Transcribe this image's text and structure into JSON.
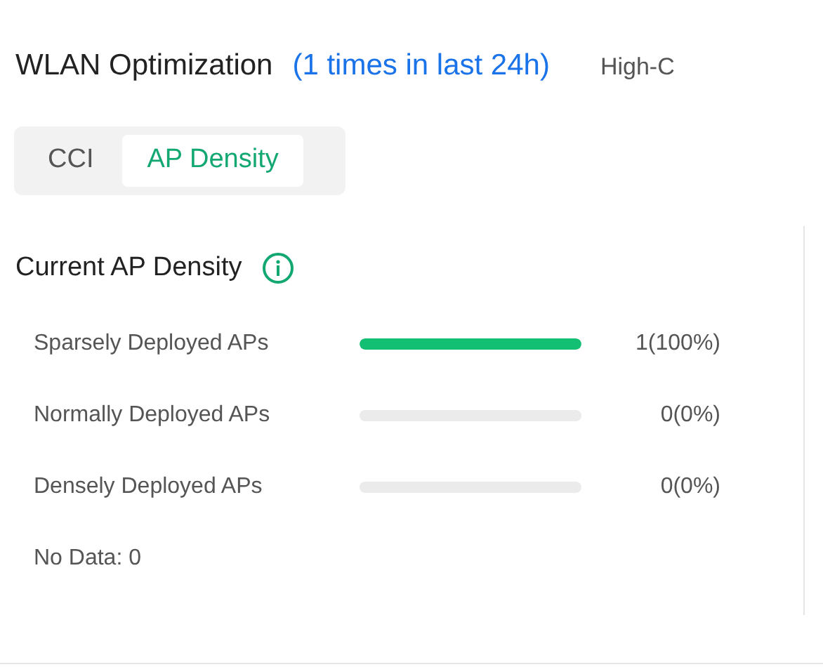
{
  "header": {
    "title": "WLAN Optimization",
    "count": "(1 times in last 24h)",
    "next_section": "High-C"
  },
  "tabs": [
    {
      "label": "CCI",
      "selected": false
    },
    {
      "label": "AP Density",
      "selected": true
    }
  ],
  "density": {
    "title": "Current AP Density",
    "rows": [
      {
        "label": "Sparsely Deployed APs",
        "level": 1,
        "reading": "1(100%)"
      },
      {
        "label": "Normally Deployed APs",
        "level": 0,
        "reading": "0(0%)"
      },
      {
        "label": "Densely Deployed APs",
        "level": 0,
        "reading": "0(0%)"
      }
    ],
    "no_data": "No Data: 0"
  }
}
